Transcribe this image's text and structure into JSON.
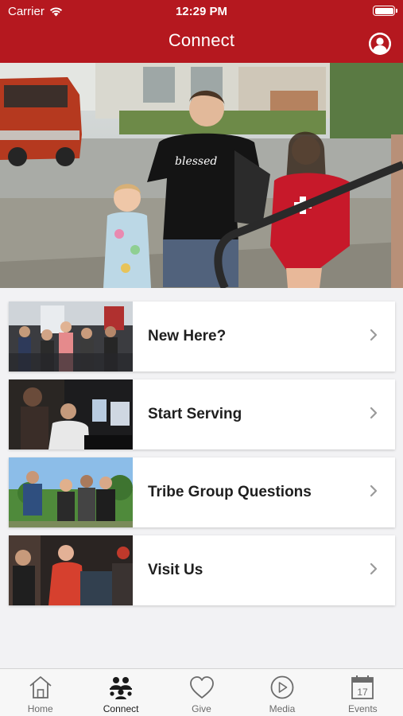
{
  "status_bar": {
    "carrier": "Carrier",
    "time": "12:29 PM"
  },
  "header": {
    "title": "Connect",
    "profile_icon": "person-icon",
    "background_color": "#b5181f"
  },
  "hero": {
    "shirt_text": "blessed"
  },
  "cards": [
    {
      "label": "New Here?",
      "thumb_icon": "congregation-photo"
    },
    {
      "label": "Start Serving",
      "thumb_icon": "volunteers-photo"
    },
    {
      "label": "Tribe Group Questions",
      "thumb_icon": "group-photo"
    },
    {
      "label": "Visit Us",
      "thumb_icon": "preacher-photo"
    }
  ],
  "tabbar": {
    "items": [
      {
        "label": "Home",
        "icon": "home-icon",
        "active": false
      },
      {
        "label": "Connect",
        "icon": "people-icon",
        "active": true
      },
      {
        "label": "Give",
        "icon": "heart-icon",
        "active": false
      },
      {
        "label": "Media",
        "icon": "play-icon",
        "active": false
      },
      {
        "label": "Events",
        "icon": "calendar-icon",
        "active": false,
        "badge_text": "17"
      }
    ]
  }
}
